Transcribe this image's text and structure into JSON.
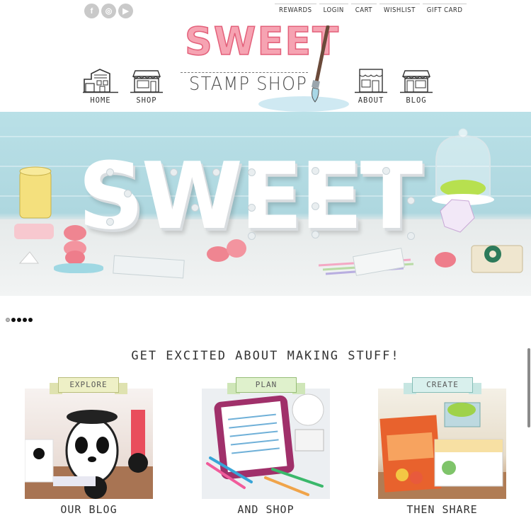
{
  "social": {
    "items": [
      {
        "icon": "facebook-icon",
        "glyph": "f"
      },
      {
        "icon": "instagram-icon",
        "glyph": "◎"
      },
      {
        "icon": "youtube-icon",
        "glyph": "▶"
      }
    ]
  },
  "util_nav": {
    "items": [
      "REWARDS",
      "LOGIN",
      "CART",
      "WISHLIST",
      "GIFT CARD"
    ]
  },
  "logo": {
    "title": "SWEET",
    "subtitle": "STAMP SHOP",
    "colors": {
      "pink": "#f6a3b2",
      "pink_outline": "#e3607a",
      "water": "#cfe9f2"
    }
  },
  "main_nav": {
    "home": "HOME",
    "shop": "SHOP",
    "about": "ABOUT",
    "blog": "BLOG"
  },
  "hero": {
    "letters": "SWEET",
    "colors": {
      "wall": "#b9e0e7",
      "table": "#eef0f0"
    }
  },
  "slider": {
    "count": 5,
    "active_index": 0
  },
  "tagline": "GET EXCITED ABOUT MAKING STUFF!",
  "cards": [
    {
      "banner": "EXPLORE",
      "caption": "OUR BLOG"
    },
    {
      "banner": "PLAN",
      "caption": "AND SHOP"
    },
    {
      "banner": "CREATE",
      "caption": "THEN SHARE"
    }
  ]
}
